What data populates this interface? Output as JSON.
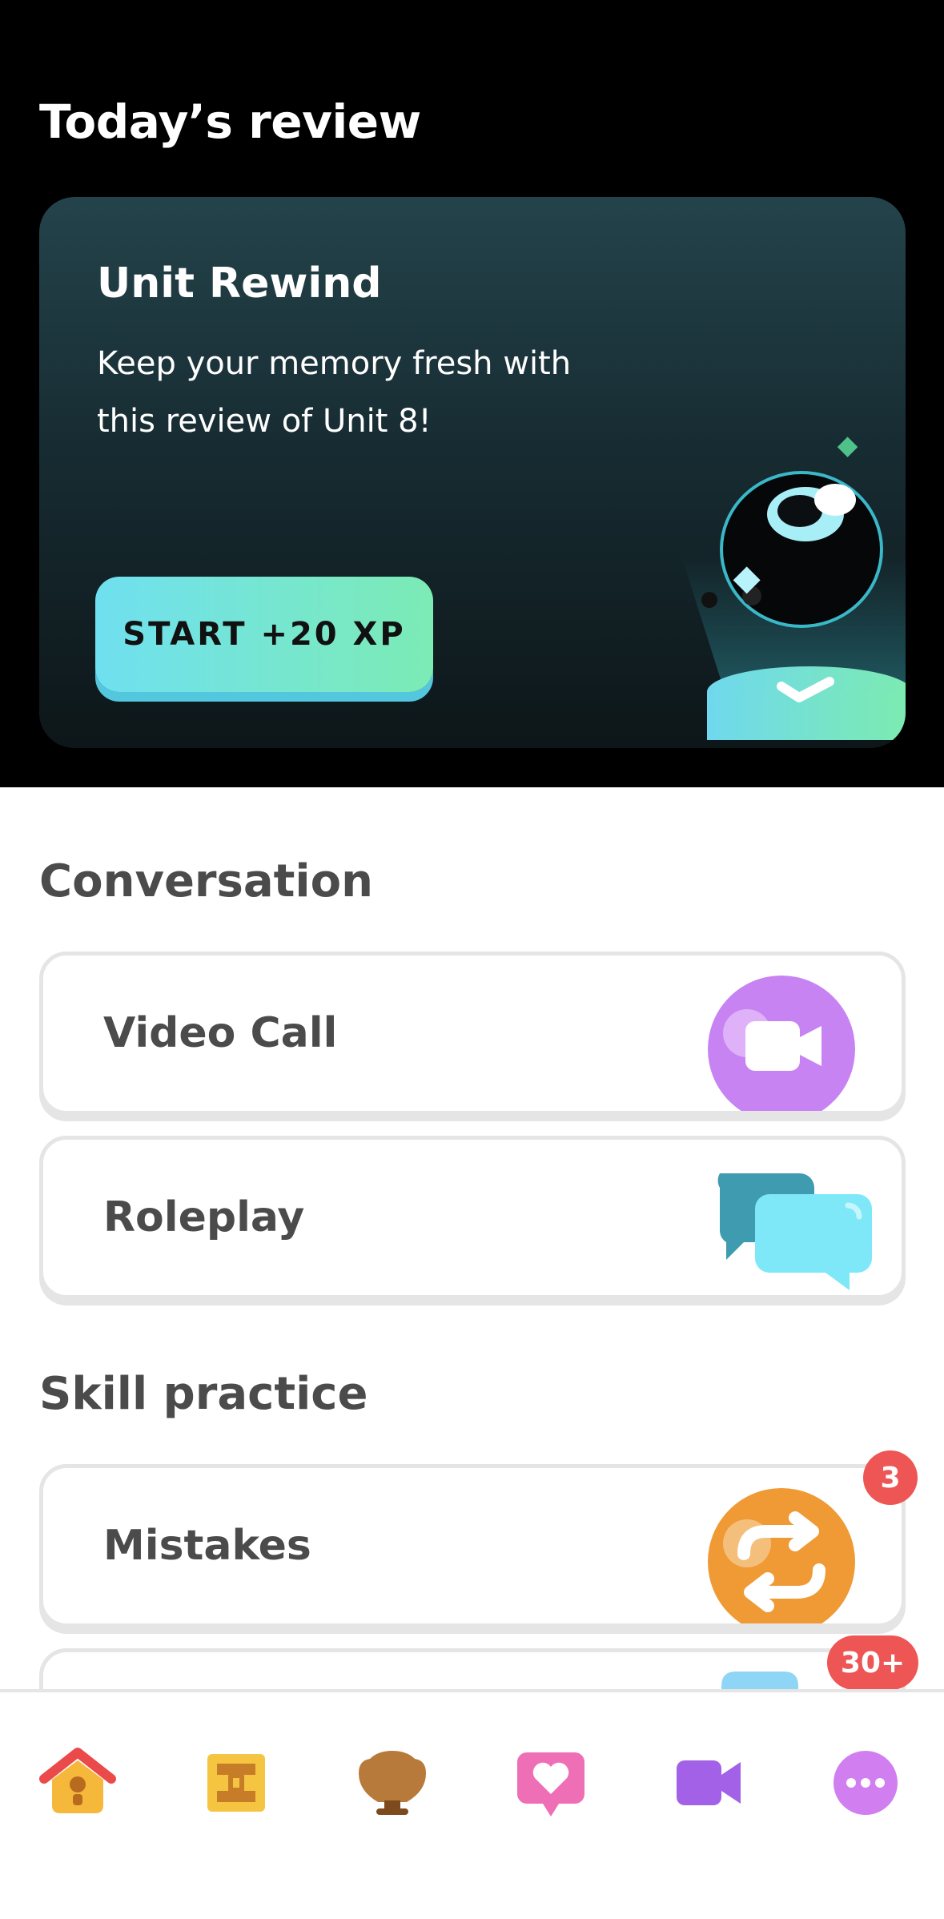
{
  "review": {
    "heading": "Today’s review",
    "card": {
      "title": "Unit Rewind",
      "description": "Keep your memory fresh with this review of Unit 8!",
      "button_label": "START +20 XP"
    }
  },
  "conversation": {
    "heading": "Conversation",
    "items": [
      {
        "label": "Video Call",
        "icon": "video-call-icon"
      },
      {
        "label": "Roleplay",
        "icon": "chat-bubbles-icon"
      }
    ]
  },
  "skill_practice": {
    "heading": "Skill practice",
    "items": [
      {
        "label": "Mistakes",
        "icon": "refresh-icon",
        "badge": "3"
      },
      {
        "label": "",
        "icon": "partial-card-icon",
        "badge": "30+"
      }
    ]
  },
  "nav": {
    "items": [
      {
        "icon": "home-icon"
      },
      {
        "icon": "treasure-chest-icon"
      },
      {
        "icon": "shield-icon"
      },
      {
        "icon": "heart-chat-icon"
      },
      {
        "icon": "video-camera-icon"
      },
      {
        "icon": "more-icon"
      }
    ]
  },
  "colors": {
    "accent_cyan": "#6fe0f0",
    "accent_green": "#7cebb5",
    "purple": "#c883f3",
    "orange": "#ef9a35",
    "badge_red": "#ee5555",
    "text_dark": "#4b4b4b"
  }
}
